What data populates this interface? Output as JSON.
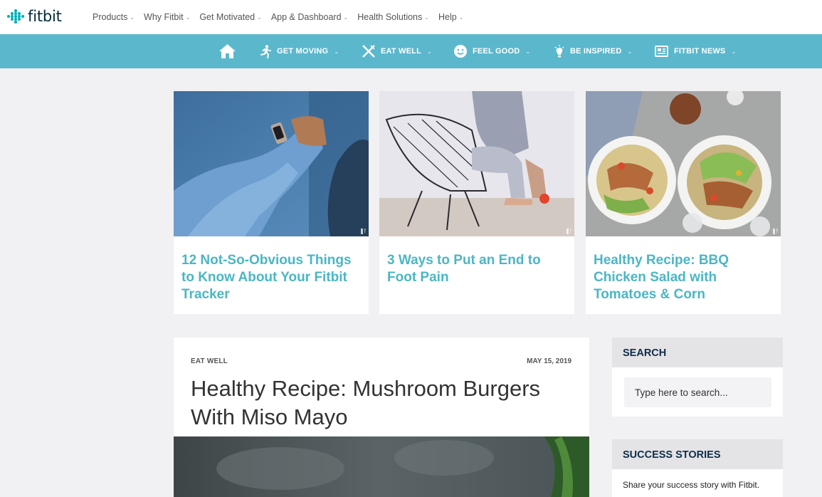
{
  "logo": {
    "text": "fitbit"
  },
  "top_menu": [
    {
      "label": "Products"
    },
    {
      "label": "Why Fitbit"
    },
    {
      "label": "Get Motivated"
    },
    {
      "label": "App & Dashboard"
    },
    {
      "label": "Health Solutions"
    },
    {
      "label": "Help"
    }
  ],
  "section_nav": {
    "home_icon": "home-icon",
    "items": [
      {
        "label": "GET MOVING",
        "icon": "running-icon"
      },
      {
        "label": "EAT WELL",
        "icon": "fork-knife-icon"
      },
      {
        "label": "FEEL GOOD",
        "icon": "smile-icon"
      },
      {
        "label": "BE INSPIRED",
        "icon": "lightbulb-icon"
      },
      {
        "label": "FITBIT NEWS",
        "icon": "newspaper-icon"
      }
    ]
  },
  "featured": [
    {
      "title": "12 Not-So-Obvious Things to Know About Your Fitbit Tracker"
    },
    {
      "title": "3 Ways to Put an End to Foot Pain"
    },
    {
      "title": "Healthy Recipe: BBQ Chicken Salad with Tomatoes & Corn"
    }
  ],
  "article": {
    "category": "EAT WELL",
    "date": "MAY 15, 2019",
    "title": "Healthy Recipe: Mushroom Burgers With Miso Mayo"
  },
  "sidebar": {
    "search": {
      "heading": "SEARCH",
      "placeholder": "Type here to search..."
    },
    "success": {
      "heading": "SUCCESS STORIES",
      "text": "Share your success story with Fitbit."
    }
  },
  "colors": {
    "teal_bar": "#5bb8cc",
    "card_title": "#4bb6c4",
    "logo_dots": "#00b0b9",
    "page_bg": "#f1f0f2"
  }
}
